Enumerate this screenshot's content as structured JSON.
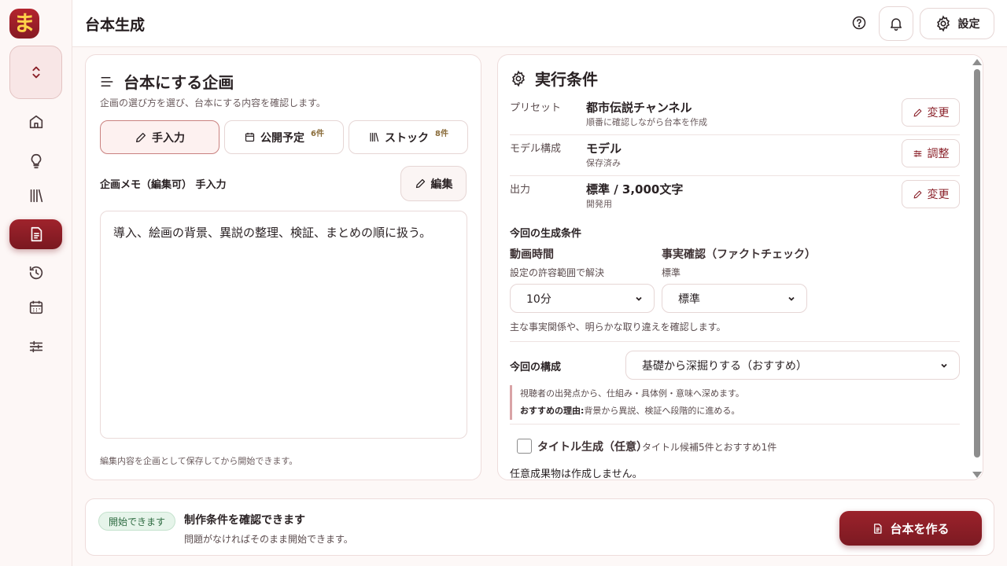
{
  "app": {
    "logo_char": "ま"
  },
  "header": {
    "title": "台本生成",
    "settings_label": "設定"
  },
  "sidebar": {
    "items": [
      {
        "name": "home",
        "icon": "home-icon"
      },
      {
        "name": "ideas",
        "icon": "lightbulb-icon"
      },
      {
        "name": "library",
        "icon": "library-icon"
      },
      {
        "name": "script",
        "icon": "document-icon",
        "active": true
      },
      {
        "name": "history",
        "icon": "history-icon"
      },
      {
        "name": "calendar",
        "icon": "calendar-icon"
      },
      {
        "name": "adjust",
        "icon": "sliders-icon"
      }
    ]
  },
  "left_panel": {
    "title": "台本にする企画",
    "subtitle": "企画の選び方を選び、台本にする内容を確認します。",
    "tabs": [
      {
        "label": "手入力",
        "count": ""
      },
      {
        "label": "公開予定",
        "count": "6件"
      },
      {
        "label": "ストック",
        "count": "8件"
      }
    ],
    "memo_label": "企画メモ（編集可） 手入力",
    "edit_label": "編集",
    "memo_text": "導入、絵画の背景、異説の整理、検証、まとめの順に扱う。",
    "footer": "編集内容を企画として保存してから開始できます。"
  },
  "right_panel": {
    "title": "実行条件",
    "rows": [
      {
        "label": "プリセット",
        "value": "都市伝説チャンネル",
        "note": "順番に確認しながら台本を作成",
        "button": "変更"
      },
      {
        "label": "モデル構成",
        "value": "モデル",
        "note": "保存済み",
        "button": "調整"
      },
      {
        "label": "出力",
        "value": "標準 / 3,000文字",
        "note": "開発用",
        "button": "変更"
      }
    ],
    "conditions_title": "今回の生成条件",
    "duration": {
      "label": "動画時間",
      "help": "設定の許容範囲で解決",
      "value": "10分"
    },
    "factcheck": {
      "label": "事実確認（ファクトチェック）",
      "help": "標準",
      "value": "標準"
    },
    "factcheck_note": "主な事実関係や、明らかな取り違えを確認します。",
    "structure": {
      "label": "今回の構成",
      "value": "基礎から深掘りする（おすすめ）"
    },
    "structure_desc": "視聴者の出発点から、仕組み・具体例・意味へ深めます。",
    "recommend_label": "おすすめの理由:",
    "recommend_text": "背景から異説、検証へ段階的に進める。",
    "title_gen": {
      "label": "タイトル生成（任意）",
      "help": "タイトル候補5件とおすすめ1件"
    },
    "optional_note": "任意成果物は作成しません。"
  },
  "bottom_bar": {
    "badge": "開始できます",
    "title": "制作条件を確認できます",
    "subtitle": "問題がなければそのまま開始できます。",
    "make_label": "台本を作る"
  },
  "colors": {
    "accent": "#8a1f27",
    "logo_text": "#ffd34a",
    "badge_bg": "#e6f4ea"
  }
}
